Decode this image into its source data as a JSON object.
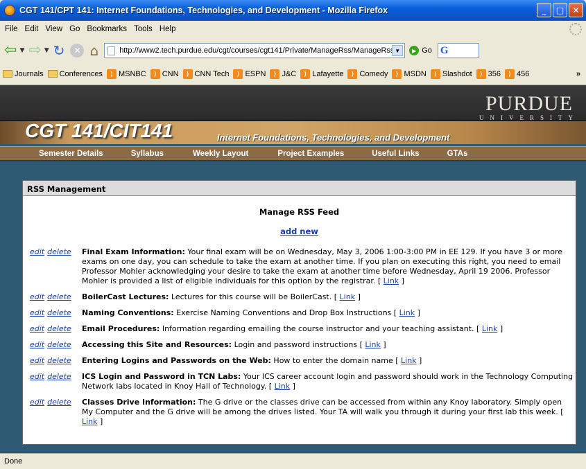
{
  "window": {
    "title": "CGT 141/CPT 141: Internet Foundations, Technologies, and Development - Mozilla Firefox"
  },
  "menu": [
    "File",
    "Edit",
    "View",
    "Go",
    "Bookmarks",
    "Tools",
    "Help"
  ],
  "nav": {
    "url": "http://www2.tech.purdue.edu/cgt/courses/cgt141/Private/ManageRss/ManageRss.",
    "go_label": "Go",
    "search_logo": "G"
  },
  "bookmarks": [
    {
      "label": "Journals",
      "icon": "folder-icon"
    },
    {
      "label": "Conferences",
      "icon": "folder-icon"
    },
    {
      "label": "MSNBC",
      "icon": "rss-icon"
    },
    {
      "label": "CNN",
      "icon": "rss-icon"
    },
    {
      "label": "CNN Tech",
      "icon": "rss-icon"
    },
    {
      "label": "ESPN",
      "icon": "rss-icon"
    },
    {
      "label": "J&C",
      "icon": "rss-icon"
    },
    {
      "label": "Lafayette",
      "icon": "rss-icon"
    },
    {
      "label": "Comedy",
      "icon": "rss-icon"
    },
    {
      "label": "MSDN",
      "icon": "rss-icon"
    },
    {
      "label": "Slashdot",
      "icon": "rss-icon"
    },
    {
      "label": "356",
      "icon": "rss-icon"
    },
    {
      "label": "456",
      "icon": "rss-icon"
    }
  ],
  "bookmarks_overflow": "»",
  "site": {
    "logo_top": "PURDUE",
    "logo_bottom": "UNIVERSITY",
    "course": "CGT 141/CIT141",
    "subtitle": "Internet Foundations, Technologies, and Development",
    "nav": [
      "Semester Details",
      "Syllabus",
      "Weekly Layout",
      "Project Examples",
      "Useful Links",
      "GTAs"
    ]
  },
  "panel": {
    "header": "RSS Management",
    "title": "Manage RSS Feed",
    "add_new": "add new",
    "edit_label": "edit",
    "delete_label": "delete",
    "link_label": "Link",
    "items": [
      {
        "title": "Final Exam Information:",
        "text": "Your final exam will be on Wednesday, May 3, 2006 1:00-3:00 PM in EE 129. If you have 3 or more exams on one day, you can schedule to take the exam at another time. If you plan on executing this right, you need to email Professor Mohler acknowledging your desire to take the exam at another time before Wednesday, April 19 2006. Professor Mohler is provided a list of eligible individuals for this option by the registrar."
      },
      {
        "title": "BoilerCast Lectures:",
        "text": "Lectures for this course will be BoilerCast."
      },
      {
        "title": "Naming Conventions:",
        "text": "Exercise Naming Conventions and Drop Box Instructions"
      },
      {
        "title": "Email Procedures:",
        "text": "Information regarding emailing the course instructor and your teaching assistant."
      },
      {
        "title": "Accessing this Site and Resources:",
        "text": "Login and password instructions"
      },
      {
        "title": "Entering Logins and Passwords on the Web:",
        "text": "How to enter the domain name"
      },
      {
        "title": "ICS Login and Password in TCN Labs:",
        "text": "Your ICS career account login and password should work in the Technology Computing Network labs located in Knoy Hall of Technology."
      },
      {
        "title": "Classes Drive Information:",
        "text": "The G drive or the classes drive can be accessed from within any Knoy laboratory. Simply open My Computer and the G drive will be among the drives listed. Your TA will walk you through it during your first lab this week."
      }
    ]
  },
  "status": "Done"
}
